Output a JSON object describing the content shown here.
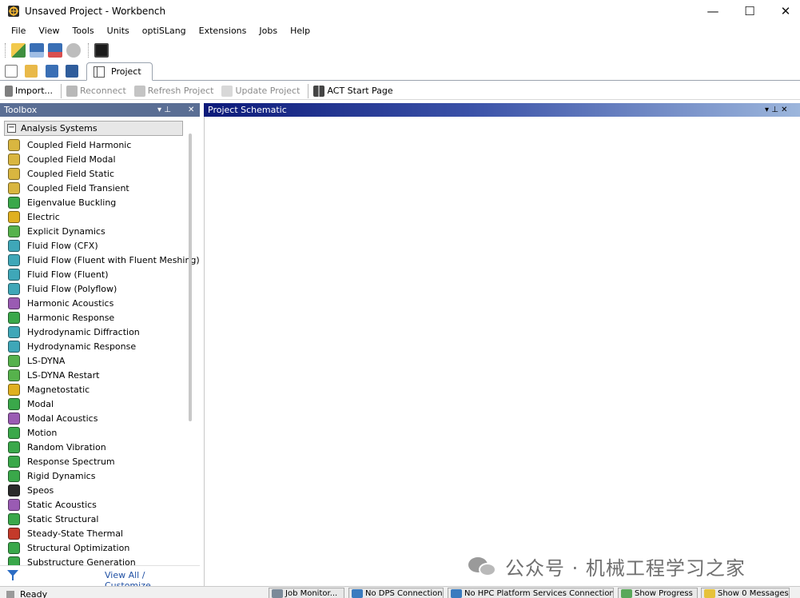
{
  "window": {
    "title": "Unsaved Project - Workbench",
    "minimize": "—",
    "maximize": "☐",
    "close": "✕"
  },
  "menu": [
    "File",
    "View",
    "Tools",
    "Units",
    "optiSLang",
    "Extensions",
    "Jobs",
    "Help"
  ],
  "tabs": {
    "project": "Project"
  },
  "action_toolbar": {
    "import": "Import...",
    "reconnect": "Reconnect",
    "refresh": "Refresh Project",
    "update": "Update Project",
    "act_start": "ACT Start Page"
  },
  "toolbox": {
    "title": "Toolbox",
    "pin": "▾  ⊥",
    "close": "✕",
    "group": "Analysis Systems",
    "group_toggle": "−",
    "items": [
      {
        "label": "Coupled Field Harmonic",
        "icon": "coupled-field-icon",
        "color": "#d9b640"
      },
      {
        "label": "Coupled Field Modal",
        "icon": "coupled-field-icon",
        "color": "#d9b640"
      },
      {
        "label": "Coupled Field Static",
        "icon": "coupled-field-icon",
        "color": "#d9b640"
      },
      {
        "label": "Coupled Field Transient",
        "icon": "coupled-field-icon",
        "color": "#d9b640"
      },
      {
        "label": "Eigenvalue Buckling",
        "icon": "buckling-icon",
        "color": "#3aa84a"
      },
      {
        "label": "Electric",
        "icon": "electric-icon",
        "color": "#e0b020"
      },
      {
        "label": "Explicit Dynamics",
        "icon": "explicit-icon",
        "color": "#56b24c"
      },
      {
        "label": "Fluid Flow (CFX)",
        "icon": "fluid-icon",
        "color": "#3fa7b8"
      },
      {
        "label": "Fluid Flow (Fluent with Fluent Meshing)",
        "icon": "fluid-icon",
        "color": "#3fa7b8"
      },
      {
        "label": "Fluid Flow (Fluent)",
        "icon": "fluid-icon",
        "color": "#3fa7b8"
      },
      {
        "label": "Fluid Flow (Polyflow)",
        "icon": "fluid-icon",
        "color": "#3fa7b8"
      },
      {
        "label": "Harmonic Acoustics",
        "icon": "acoustics-icon",
        "color": "#9a5bb3"
      },
      {
        "label": "Harmonic Response",
        "icon": "harmonic-icon",
        "color": "#3aa84a"
      },
      {
        "label": "Hydrodynamic Diffraction",
        "icon": "hydro-icon",
        "color": "#3fa7b8"
      },
      {
        "label": "Hydrodynamic Response",
        "icon": "hydro-icon",
        "color": "#3fa7b8"
      },
      {
        "label": "LS-DYNA",
        "icon": "lsdyna-icon",
        "color": "#56b24c"
      },
      {
        "label": "LS-DYNA Restart",
        "icon": "lsdyna-icon",
        "color": "#56b24c"
      },
      {
        "label": "Magnetostatic",
        "icon": "magnet-icon",
        "color": "#e0b020"
      },
      {
        "label": "Modal",
        "icon": "modal-icon",
        "color": "#3aa84a"
      },
      {
        "label": "Modal Acoustics",
        "icon": "acoustics-icon",
        "color": "#9a5bb3"
      },
      {
        "label": "Motion",
        "icon": "motion-icon",
        "color": "#3aa84a"
      },
      {
        "label": "Random Vibration",
        "icon": "vibration-icon",
        "color": "#3aa84a"
      },
      {
        "label": "Response Spectrum",
        "icon": "spectrum-icon",
        "color": "#3aa84a"
      },
      {
        "label": "Rigid Dynamics",
        "icon": "rigid-icon",
        "color": "#3aa84a"
      },
      {
        "label": "Speos",
        "icon": "speos-icon",
        "color": "#2a2a2a"
      },
      {
        "label": "Static Acoustics",
        "icon": "acoustics-icon",
        "color": "#9a5bb3"
      },
      {
        "label": "Static Structural",
        "icon": "structural-icon",
        "color": "#3aa84a"
      },
      {
        "label": "Steady-State Thermal",
        "icon": "thermal-icon",
        "color": "#c43a2a"
      },
      {
        "label": "Structural Optimization",
        "icon": "optimization-icon",
        "color": "#3aa84a"
      },
      {
        "label": "Substructure Generation",
        "icon": "substructure-icon",
        "color": "#3aa84a"
      }
    ],
    "view_all": "View All / Customize..."
  },
  "schematic": {
    "title": "Project Schematic",
    "controls": "▾  ⊥  ✕"
  },
  "watermark": "公众号 · 机械工程学习之家",
  "status": {
    "ready": "Ready",
    "job_monitor": "Job Monitor...",
    "dps": "No DPS Connection",
    "hpc": "No HPC Platform Services Connection",
    "progress": "Show Progress",
    "messages": "Show 0 Messages"
  }
}
